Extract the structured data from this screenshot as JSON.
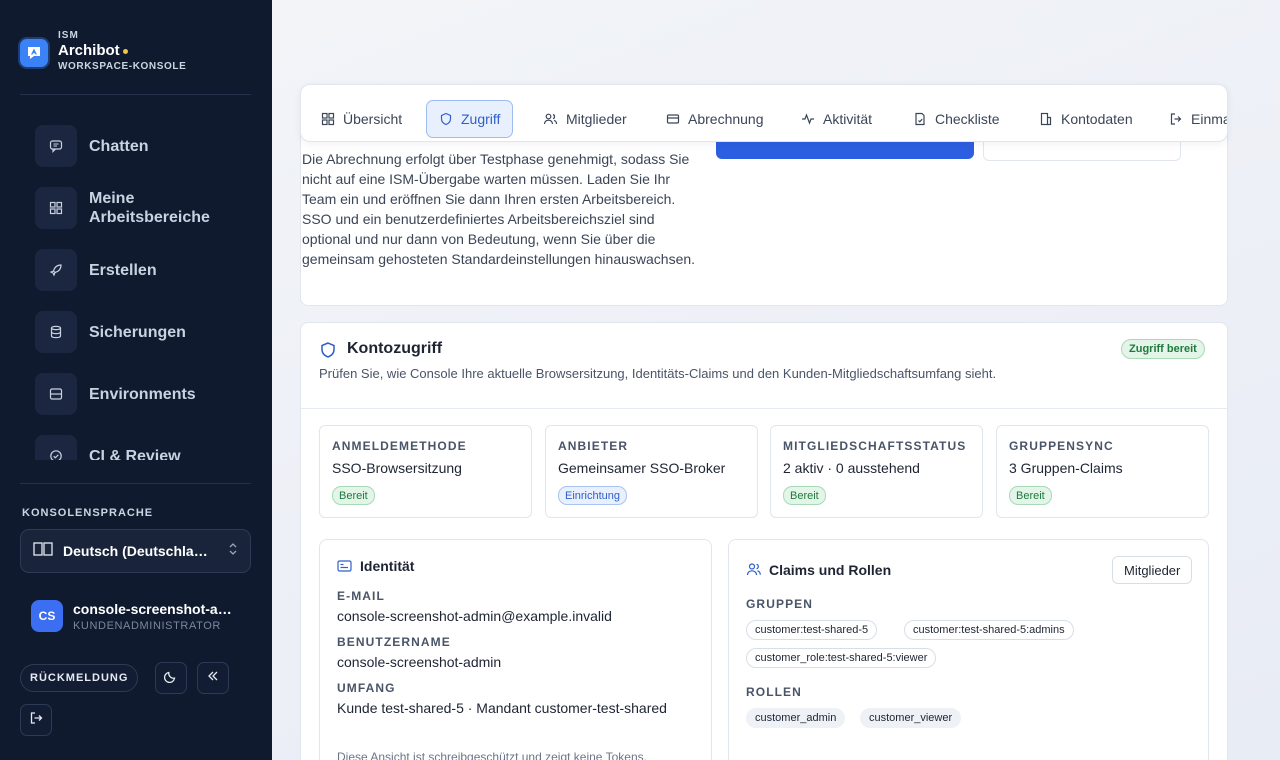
{
  "brand": {
    "kicker": "ISM",
    "name": "Archibot",
    "subtitle": "WORKSPACE-KONSOLE"
  },
  "nav": {
    "items": [
      {
        "label": "Chatten",
        "icon": "chat-icon"
      },
      {
        "label": "Meine Arbeitsbereiche",
        "icon": "grid-icon"
      },
      {
        "label": "Erstellen",
        "icon": "rocket-icon"
      },
      {
        "label": "Sicherungen",
        "icon": "database-icon"
      },
      {
        "label": "Environments",
        "icon": "server-icon"
      },
      {
        "label": "CI & Review",
        "icon": "check-circle-icon"
      }
    ]
  },
  "language": {
    "title": "KONSOLENSPRACHE",
    "selected": "Deutsch (Deutschland)"
  },
  "user": {
    "initials": "CS",
    "name": "console-screenshot-admin",
    "role": "KUNDENADMINISTRATOR"
  },
  "footer": {
    "feedback": "RÜCKMELDUNG"
  },
  "tabs": [
    {
      "label": "Übersicht",
      "icon": "grid-icon"
    },
    {
      "label": "Zugriff",
      "icon": "shield-icon",
      "active": true
    },
    {
      "label": "Mitglieder",
      "icon": "users-icon"
    },
    {
      "label": "Abrechnung",
      "icon": "card-icon"
    },
    {
      "label": "Aktivität",
      "icon": "activity-icon"
    },
    {
      "label": "Checkliste",
      "icon": "checklist-icon"
    },
    {
      "label": "Kontodaten",
      "icon": "building-icon"
    },
    {
      "label": "Einmal",
      "icon": "sign-in-icon"
    }
  ],
  "intro": {
    "text": "Die Abrechnung erfolgt über Testphase genehmigt, sodass Sie nicht auf eine ISM-Übergabe warten müssen. Laden Sie Ihr Team ein und eröffnen Sie dann Ihren ersten Arbeitsbereich. SSO und ein benutzerdefiniertes Arbeitsbereichsziel sind optional und nur dann von Bedeutung, wenn Sie über die gemeinsam gehosteten Standardeinstellungen hinauswachsen."
  },
  "access": {
    "title": "Kontozugriff",
    "badge": "Zugriff bereit",
    "description": "Prüfen Sie, wie Console Ihre aktuelle Browsersitzung, Identitäts-Claims und den Kunden-Mitgliedschaftsumfang sieht.",
    "stats": [
      {
        "label": "ANMELDEMETHODE",
        "value": "SSO-Browsersitzung",
        "status": "Bereit",
        "tone": "green"
      },
      {
        "label": "ANBIETER",
        "value": "Gemeinsamer SSO-Broker",
        "status": "Einrichtung",
        "tone": "blue"
      },
      {
        "label": "MITGLIEDSCHAFTSSTATUS",
        "value": "2 aktiv · 0 ausstehend",
        "status": "Bereit",
        "tone": "green"
      },
      {
        "label": "GRUPPENSYNC",
        "value": "3 Gruppen-Claims",
        "status": "Bereit",
        "tone": "green"
      }
    ]
  },
  "identity": {
    "title": "Identität",
    "email_label": "E-MAIL",
    "email": "console-screenshot-admin@example.invalid",
    "username_label": "BENUTZERNAME",
    "username": "console-screenshot-admin",
    "scope_label": "UMFANG",
    "scope": "Kunde test-shared-5 · Mandant customer-test-shared",
    "note": "Diese Ansicht ist schreibgeschützt und zeigt keine Tokens."
  },
  "claims": {
    "title": "Claims und Rollen",
    "members_button": "Mitglieder",
    "groups_label": "GRUPPEN",
    "groups": [
      "customer:test-shared-5",
      "customer:test-shared-5:admins",
      "customer_role:test-shared-5:viewer"
    ],
    "roles_label": "ROLLEN",
    "roles": [
      "customer_admin",
      "customer_viewer"
    ]
  },
  "colors": {
    "sidebar": "#0f1a2e",
    "accent": "#2b5ee0",
    "success": "#1f7a3d"
  }
}
